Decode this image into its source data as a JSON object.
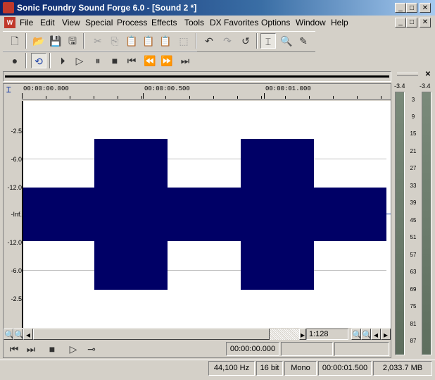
{
  "window": {
    "title": "Sonic Foundry Sound Forge 6.0 - [Sound 2 *]",
    "controls": [
      "_",
      "□",
      "✕"
    ]
  },
  "menu": {
    "items": [
      "File",
      "Edit",
      "View",
      "Special",
      "Process",
      "Effects",
      "Tools",
      "DX Favorites",
      "Options",
      "Window",
      "Help"
    ],
    "mdi_controls": [
      "_",
      "□",
      "✕"
    ]
  },
  "ruler": {
    "ticks": [
      "00:00:00.000",
      "00:00:00.500",
      "00:00:01.000"
    ]
  },
  "db_scale": [
    "-2.5",
    "-6.0",
    "-12.0",
    "-Inf.",
    "-12.0",
    "-6.0",
    "-2.5"
  ],
  "meter": {
    "peak_left": "-3.4",
    "peak_right": "-3.4",
    "ticks": [
      "3",
      "9",
      "15",
      "21",
      "27",
      "33",
      "39",
      "45",
      "51",
      "57",
      "63",
      "69",
      "75",
      "81",
      "87"
    ]
  },
  "navigation": {
    "zoom_ratio": "1:128"
  },
  "transport_bottom": {
    "position": "00:00:00.000"
  },
  "status": {
    "sample_rate": "44,100 Hz",
    "bit_depth": "16 bit",
    "channels": "Mono",
    "length": "00:00:01.500",
    "free_space": "2,033.7 MB"
  }
}
